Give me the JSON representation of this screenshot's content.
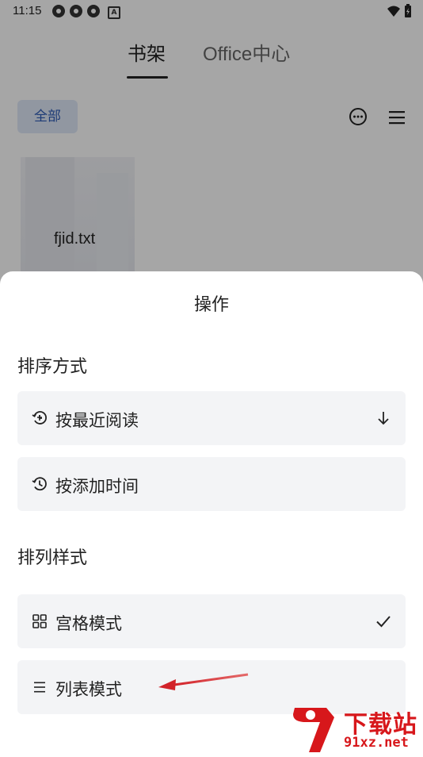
{
  "status_bar": {
    "time": "11:15",
    "notif_badge": "A"
  },
  "tabs": [
    {
      "label": "书架",
      "active": true
    },
    {
      "label": "Office中心",
      "active": false
    }
  ],
  "toolbar": {
    "filter_label": "全部"
  },
  "book": {
    "title": "fjid.txt"
  },
  "sheet": {
    "title": "操作",
    "sort_section": "排序方式",
    "sort_options": [
      {
        "label": "按最近阅读",
        "icon": "recent-read-icon",
        "trailing": "arrow-down-icon"
      },
      {
        "label": "按添加时间",
        "icon": "clock-icon"
      }
    ],
    "style_section": "排列样式",
    "style_options": [
      {
        "label": "宫格模式",
        "icon": "grid-icon",
        "trailing": "check-icon",
        "selected": true
      },
      {
        "label": "列表模式",
        "icon": "list-icon",
        "selected": false
      }
    ]
  },
  "annotation": {
    "arrow_color": "#d2232a"
  },
  "watermark": {
    "text": "下载站",
    "url": "91xz.net"
  },
  "colors": {
    "accent_blue": "#2d5bb5",
    "chip_bg": "#dfe8f7",
    "option_bg": "#f3f4f6"
  }
}
